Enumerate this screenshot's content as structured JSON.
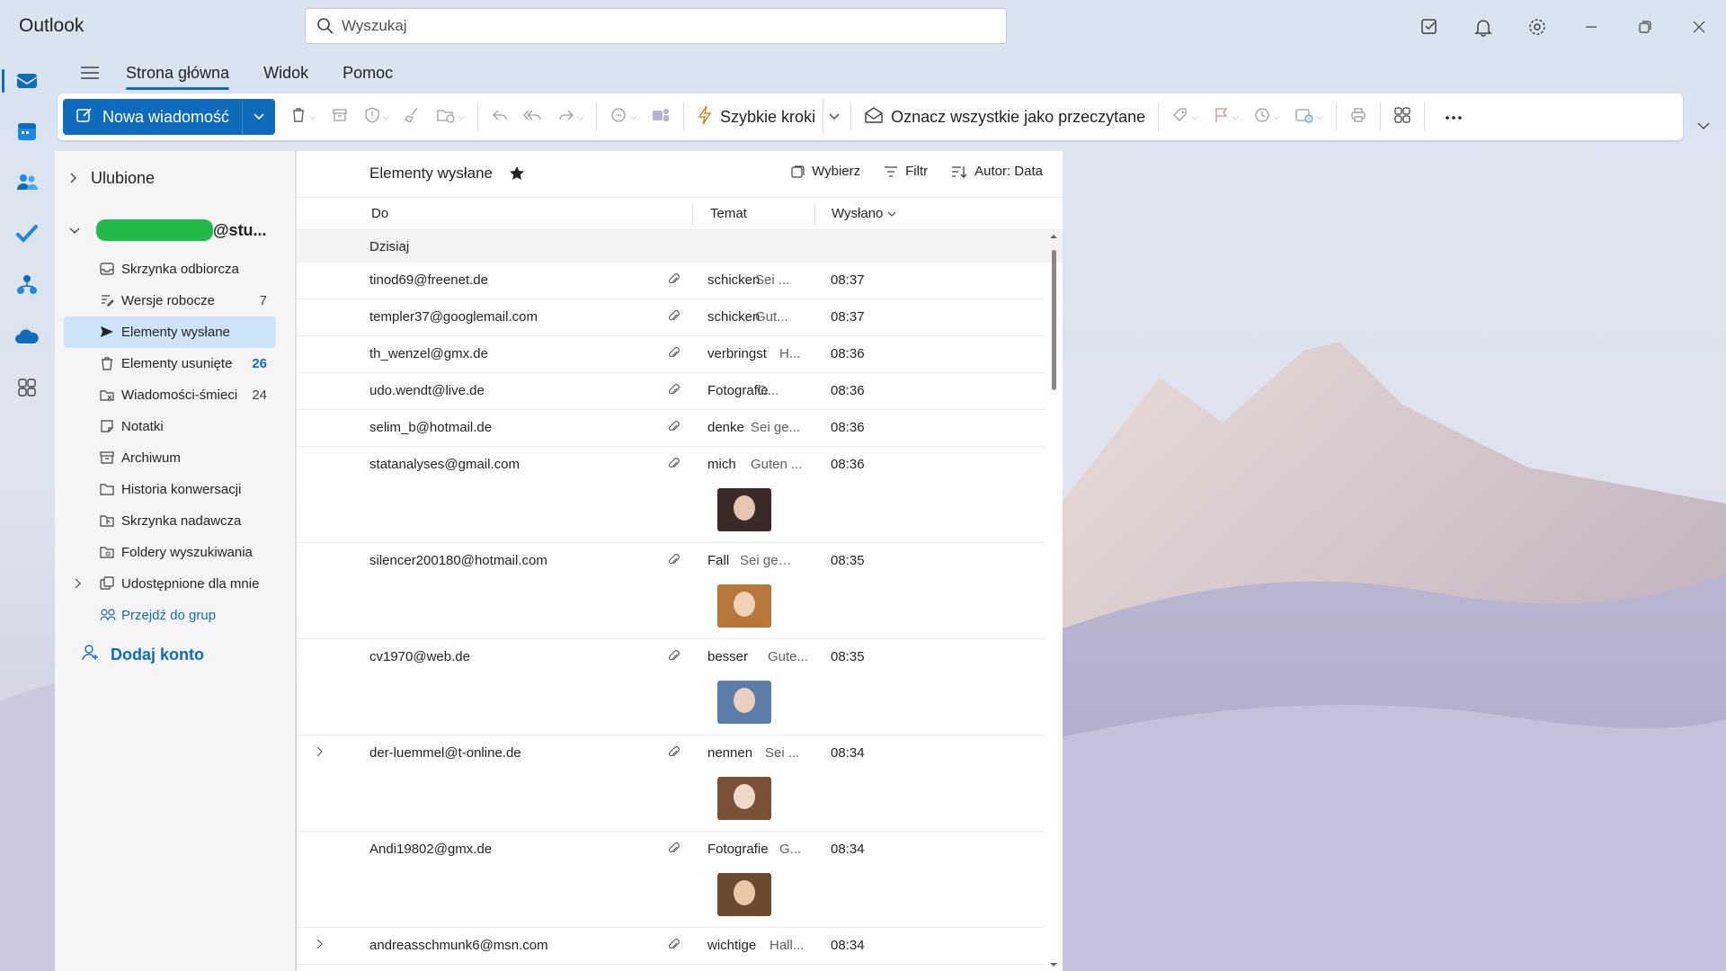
{
  "app": {
    "title": "Outlook"
  },
  "search": {
    "placeholder": "Wyszukaj"
  },
  "tabs": [
    {
      "label": "Strona główna",
      "active": true
    },
    {
      "label": "Widok"
    },
    {
      "label": "Pomoc"
    }
  ],
  "ribbon": {
    "new_message": "Nowa wiadomość",
    "quick_steps": "Szybkie kroki",
    "mark_all_read": "Oznacz wszystkie jako przeczytane"
  },
  "sidebar": {
    "favorites": "Ulubione",
    "account_suffix": "@stu...",
    "folders": [
      {
        "label": "Skrzynka odbiorcza",
        "icon": "inbox-icon",
        "count": ""
      },
      {
        "label": "Wersje robocze",
        "icon": "drafts-icon",
        "count": "7"
      },
      {
        "label": "Elementy wysłane",
        "icon": "send-icon",
        "count": "",
        "selected": true
      },
      {
        "label": "Elementy usunięte",
        "icon": "trash-icon",
        "count": "26"
      },
      {
        "label": "Wiadomości-śmieci",
        "icon": "junk-icon",
        "count": "24"
      },
      {
        "label": "Notatki",
        "icon": "note-icon",
        "count": ""
      },
      {
        "label": "Archiwum",
        "icon": "archive-icon",
        "count": ""
      },
      {
        "label": "Historia konwersacji",
        "icon": "folder-icon",
        "count": ""
      },
      {
        "label": "Skrzynka nadawcza",
        "icon": "outbox-icon",
        "count": ""
      },
      {
        "label": "Foldery wyszukiwania",
        "icon": "search-folder-icon",
        "count": ""
      },
      {
        "label": "Udostępnione dla mnie",
        "icon": "shared-icon",
        "count": ""
      },
      {
        "label": "Przejdź do grup",
        "icon": "groups-icon",
        "count": ""
      }
    ],
    "add_account": "Dodaj konto"
  },
  "maillist": {
    "title": "Elementy wysłane",
    "select": "Wybierz",
    "filter": "Filtr",
    "sort": "Autor: Data",
    "col_to": "Do",
    "col_subject": "Temat",
    "col_sent": "Wysłano",
    "group": "Dzisiaj",
    "rows": [
      {
        "to": "tinod69@freenet.de",
        "subject": "schicken",
        "preview": "Sei ...",
        "time": "08:37"
      },
      {
        "to": "templer37@googlemail.com",
        "subject": "schicken",
        "preview": "Gut...",
        "time": "08:37"
      },
      {
        "to": "th_wenzel@gmx.de",
        "subject": "verbringst",
        "preview": "H...",
        "time": "08:36"
      },
      {
        "to": "udo.wendt@live.de",
        "subject": "Fotografie",
        "preview": "G...",
        "time": "08:36"
      },
      {
        "to": "selim_b@hotmail.de",
        "subject": "denke",
        "preview": "Sei ge...",
        "time": "08:36"
      },
      {
        "to": "statanalyses@gmail.com",
        "subject": "mich",
        "preview": "Guten ...",
        "time": "08:36"
      },
      {
        "to": "silencer200180@hotmail.com",
        "subject": "Fall",
        "preview": "Sei gegr...",
        "time": "08:35"
      },
      {
        "to": "cv1970@web.de",
        "subject": "besser",
        "preview": "Gute...",
        "time": "08:35"
      },
      {
        "to": "der-luemmel@t-online.de",
        "subject": "nennen",
        "preview": "Sei ...",
        "time": "08:34"
      },
      {
        "to": "Andi19802@gmx.de",
        "subject": "Fotografie",
        "preview": "G...",
        "time": "08:34"
      },
      {
        "to": "andreasschmunk6@msn.com",
        "subject": "wichtige",
        "preview": "Hall...",
        "time": "08:34"
      }
    ]
  },
  "colors": {
    "accent": "#0f6cbd",
    "selected": "#cfe4fa"
  }
}
